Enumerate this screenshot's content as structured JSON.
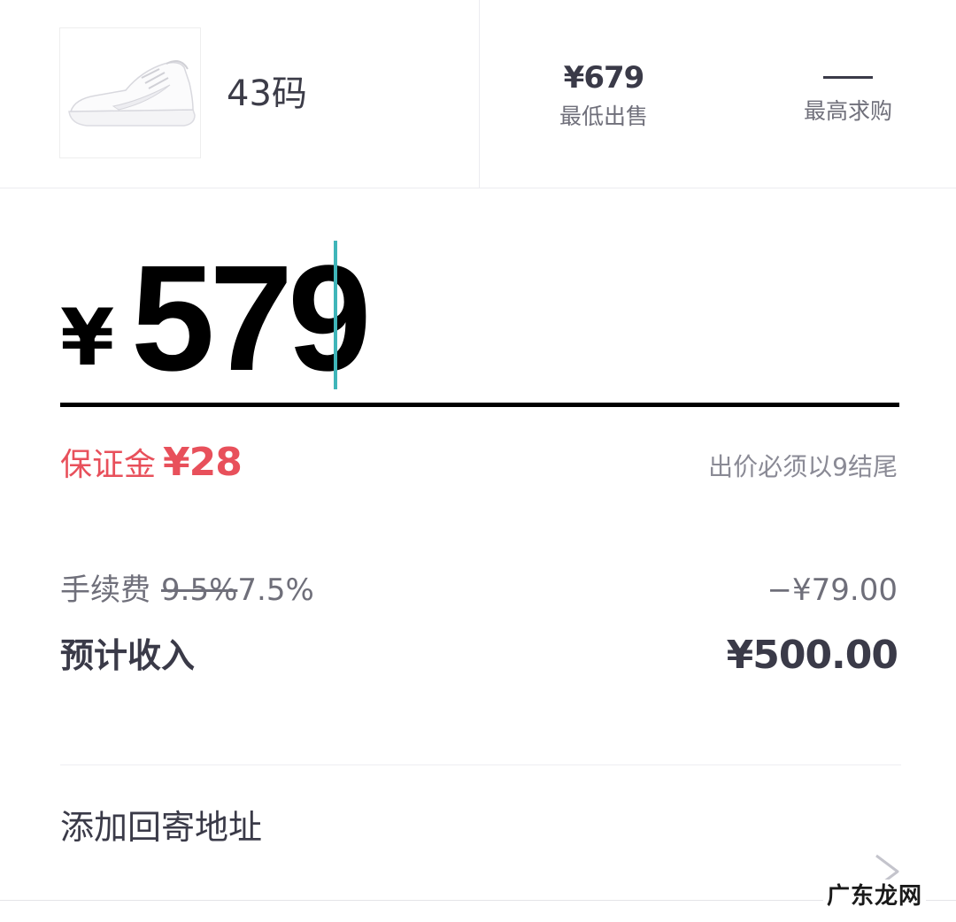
{
  "product": {
    "image_alt": "white low-top sneaker",
    "size": "43码"
  },
  "stats": {
    "lowest_sale_value": "¥679",
    "lowest_sale_label": "最低出售",
    "highest_bid_value": "—",
    "highest_bid_label": "最高求购"
  },
  "price_input": {
    "currency": "¥",
    "value": "579"
  },
  "deposit": {
    "label": "保证金",
    "value": "¥28",
    "hint": "出价必须以9结尾"
  },
  "fees": {
    "label": "手续费",
    "old_rate": "9.5%",
    "new_rate": "7.5%",
    "amount": "−¥79.00"
  },
  "income": {
    "label": "预计收入",
    "amount": "¥500.00"
  },
  "address": {
    "label": "添加回寄地址",
    "icon": "chevron-right-icon"
  },
  "watermark": "广东龙网",
  "colors": {
    "deposit_red": "#e8505b",
    "caret_teal": "#3fb5b9"
  }
}
